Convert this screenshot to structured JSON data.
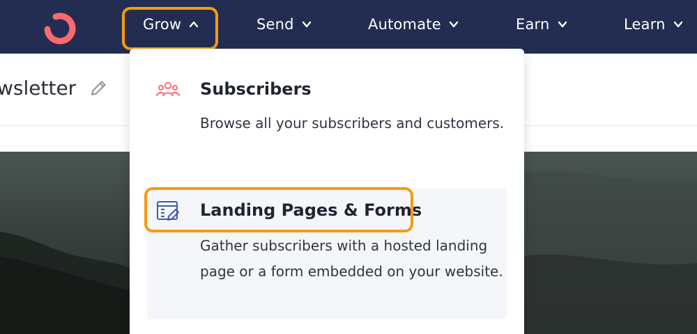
{
  "nav": {
    "items": [
      {
        "label": "Grow",
        "chevron": "chevron-up-icon"
      },
      {
        "label": "Send",
        "chevron": "chevron-down-icon"
      },
      {
        "label": "Automate",
        "chevron": "chevron-down-icon"
      },
      {
        "label": "Earn",
        "chevron": "chevron-down-icon"
      },
      {
        "label": "Learn",
        "chevron": "chevron-down-icon"
      }
    ],
    "logo": "convertkit-logo-icon"
  },
  "page": {
    "title": "wsletter",
    "edit_icon": "pencil-icon"
  },
  "dropdown": {
    "items": [
      {
        "title": "Subscribers",
        "description": "Browse all your subscribers and customers.",
        "icon": "users-icon"
      },
      {
        "title": "Landing Pages & Forms",
        "description": "Gather subscribers with a hosted landing page or a form embedded on your website.",
        "icon": "landing-page-edit-icon"
      }
    ]
  },
  "colors": {
    "nav_bg": "#232d52",
    "brand": "#fb6970",
    "highlight": "#f79a12",
    "icon_blue": "#3d5ca8"
  }
}
